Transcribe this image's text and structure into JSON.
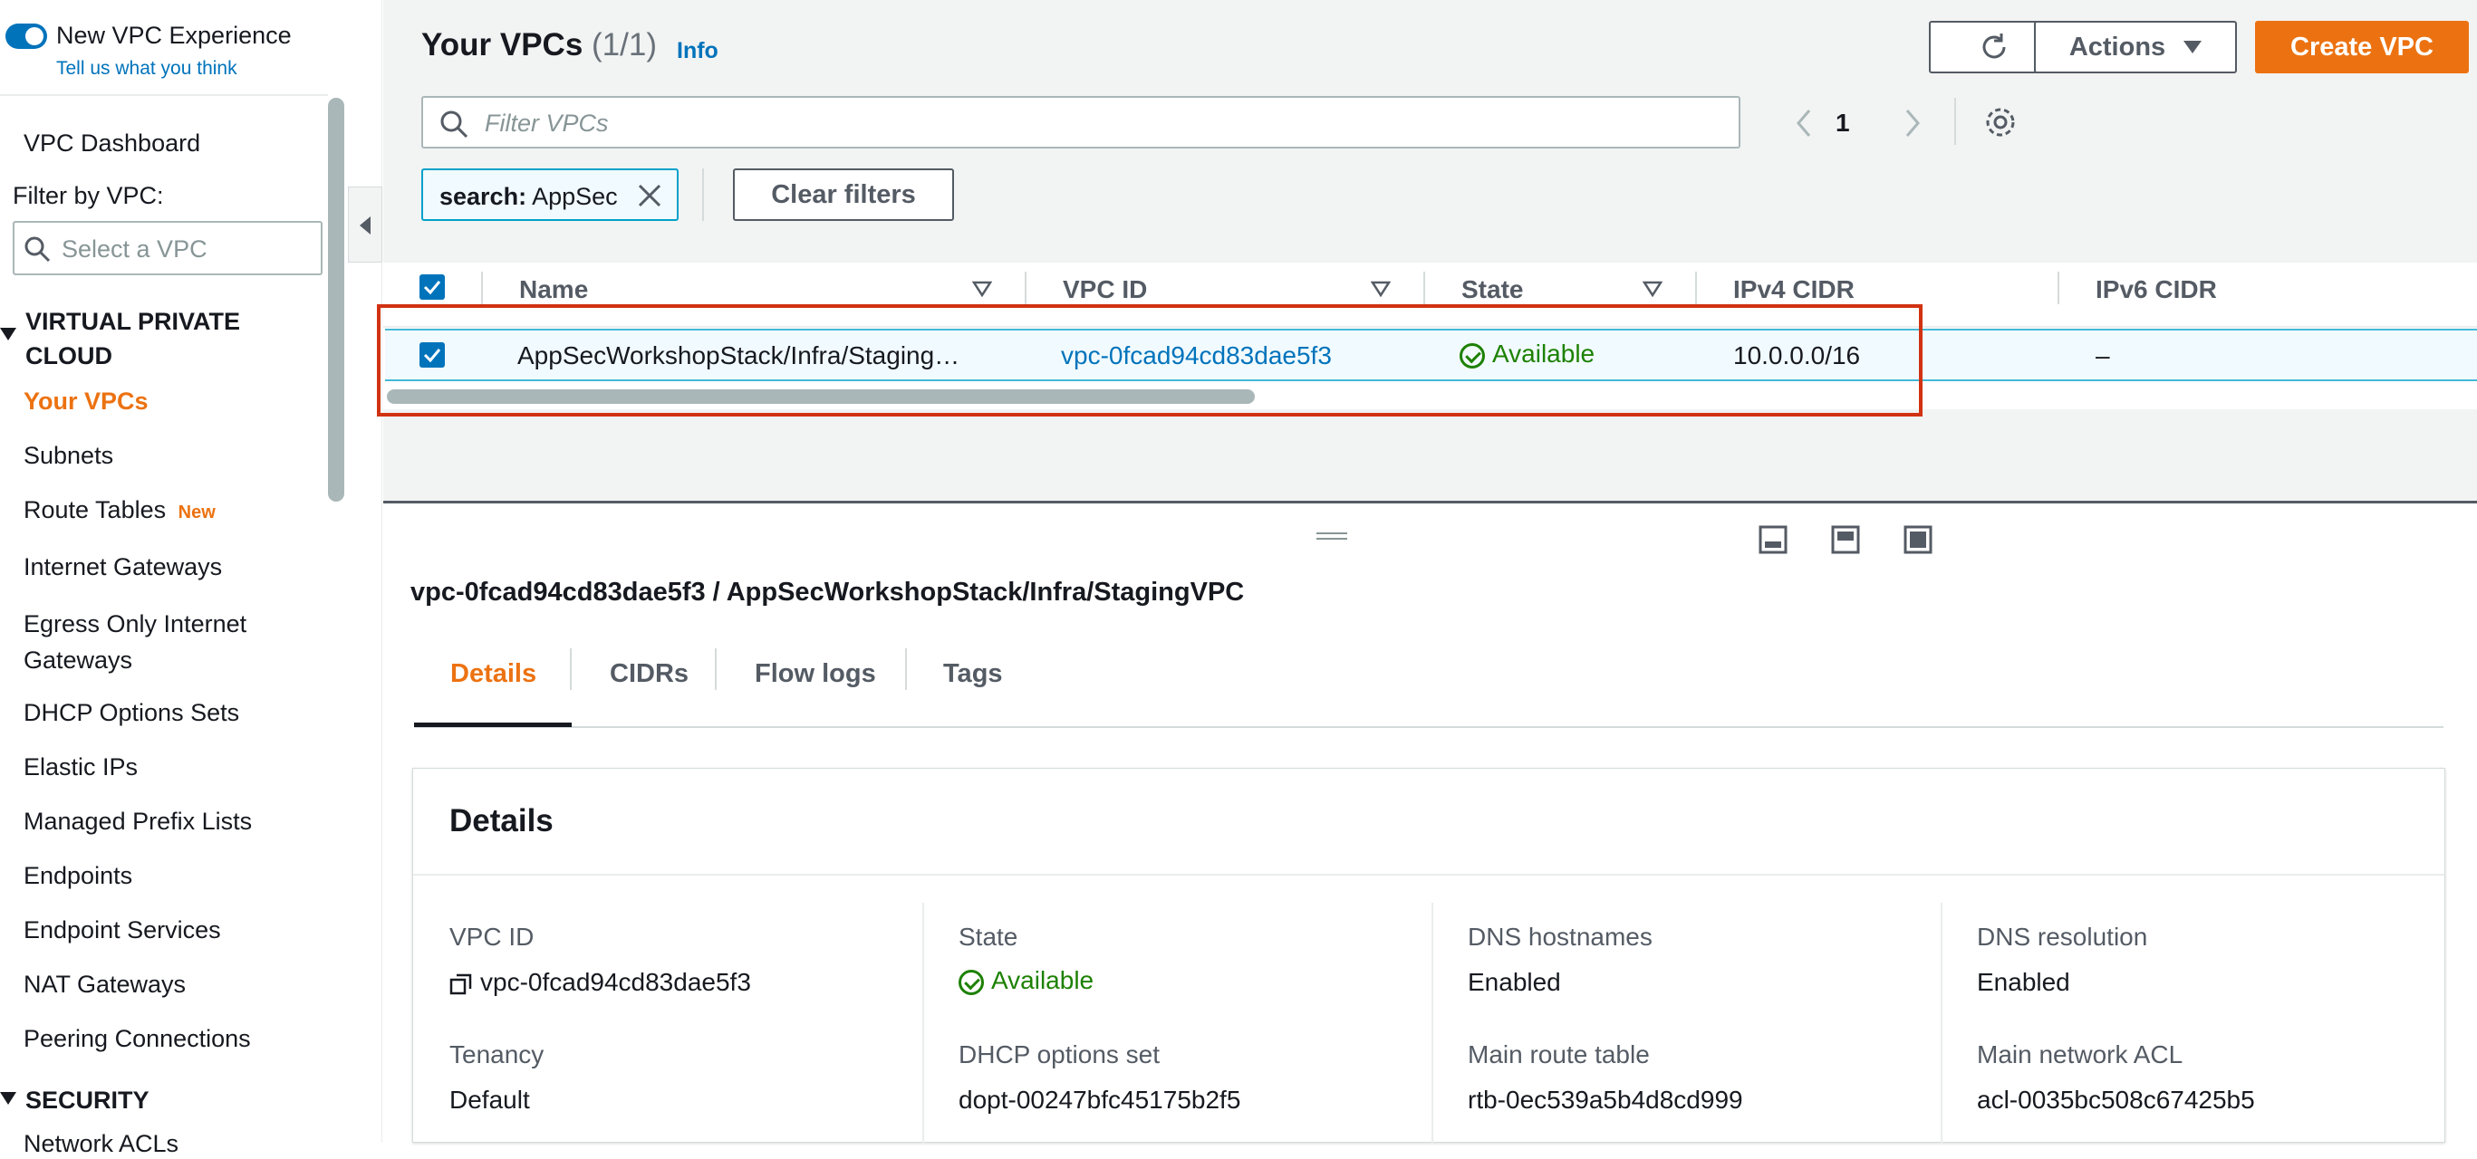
{
  "sidebar": {
    "toggle_label": "New VPC Experience",
    "feedback_link": "Tell us what you think",
    "dashboard": "VPC Dashboard",
    "filter_label": "Filter by VPC:",
    "filter_placeholder": "Select a VPC",
    "section_vpc": "VIRTUAL PRIVATE CLOUD",
    "items": [
      {
        "label": "Your VPCs",
        "active": true
      },
      {
        "label": "Subnets"
      },
      {
        "label": "Route Tables",
        "badge": "New"
      },
      {
        "label": "Internet Gateways"
      },
      {
        "label": "Egress Only Internet Gateways"
      },
      {
        "label": "DHCP Options Sets"
      },
      {
        "label": "Elastic IPs"
      },
      {
        "label": "Managed Prefix Lists"
      },
      {
        "label": "Endpoints"
      },
      {
        "label": "Endpoint Services"
      },
      {
        "label": "NAT Gateways"
      },
      {
        "label": "Peering Connections"
      }
    ],
    "section_security": "SECURITY",
    "partial_item": "Network ACLs"
  },
  "header": {
    "title": "Your VPCs",
    "count": "(1/1)",
    "info": "Info",
    "actions_label": "Actions",
    "create_label": "Create VPC",
    "filter_placeholder": "Filter VPCs",
    "page_number": "1"
  },
  "filter_token": {
    "key": "search:",
    "value": "AppSec"
  },
  "clear_filters": "Clear filters",
  "table": {
    "columns": [
      "Name",
      "VPC ID",
      "State",
      "IPv4 CIDR",
      "IPv6 CIDR"
    ],
    "rows": [
      {
        "name": "AppSecWorkshopStack/Infra/Staging…",
        "vpc_id": "vpc-0fcad94cd83dae5f3",
        "state": "Available",
        "ipv4": "10.0.0.0/16",
        "ipv6": "–"
      }
    ]
  },
  "detail": {
    "title": "vpc-0fcad94cd83dae5f3 / AppSecWorkshopStack/Infra/StagingVPC",
    "tabs": [
      "Details",
      "CIDRs",
      "Flow logs",
      "Tags"
    ],
    "active_tab": "Details",
    "card_title": "Details",
    "fields": {
      "vpc_id_label": "VPC ID",
      "vpc_id_value": "vpc-0fcad94cd83dae5f3",
      "state_label": "State",
      "state_value": "Available",
      "dns_hostnames_label": "DNS hostnames",
      "dns_hostnames_value": "Enabled",
      "dns_resolution_label": "DNS resolution",
      "dns_resolution_value": "Enabled",
      "tenancy_label": "Tenancy",
      "tenancy_value": "Default",
      "dhcp_label": "DHCP options set",
      "dhcp_value": "dopt-00247bfc45175b2f5",
      "route_label": "Main route table",
      "route_value": "rtb-0ec539a5b4d8cd999",
      "acl_label": "Main network ACL",
      "acl_value": "acl-0035bc508c67425b5"
    }
  },
  "colors": {
    "accent": "#ec7211",
    "link": "#0073bb",
    "success": "#1d8102",
    "highlight": "#d13212"
  }
}
